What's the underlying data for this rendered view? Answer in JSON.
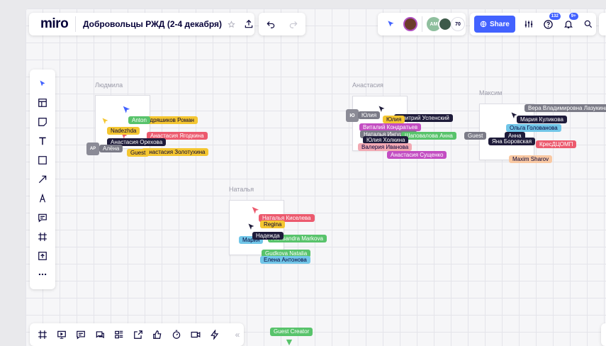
{
  "header": {
    "logo": "miro",
    "board_title": "Добровольцы РЖД (2-4 декабря)",
    "share_label": "Share",
    "collaborator_count": "70",
    "avatar_initials": "AM",
    "help_badge": "132",
    "notification_badge": "9+"
  },
  "left_toolbar": {
    "tools": [
      "select-tool",
      "templates-tool",
      "sticky-note-tool",
      "text-tool",
      "shape-tool",
      "pen-tool",
      "draw-tool",
      "comment-tool",
      "frame-tool",
      "upload-tool",
      "more-tools"
    ]
  },
  "frames": [
    {
      "label": "Людмила"
    },
    {
      "label": "Анастасия"
    },
    {
      "label": "Максим"
    },
    {
      "label": "Наталья"
    }
  ],
  "cursors_lyudmila": [
    {
      "text": "Anton",
      "color": "#58c36b"
    },
    {
      "text": "Кудряшиков Роман",
      "color": "#f4c631"
    },
    {
      "text": "Nadezhda",
      "color": "#f4c631"
    },
    {
      "text": "Анастасия Ягодкина",
      "color": "#ec5a6e"
    },
    {
      "text": "Анастасия Орехова",
      "color": "#1e1b3a"
    },
    {
      "text": "Анастасия Золотухина",
      "color": "#f4c631"
    },
    {
      "text": "Guest",
      "color": "#f4c631"
    },
    {
      "text": "Алёна",
      "color": "#7b7b87"
    },
    {
      "avatar": "AP"
    }
  ],
  "cursors_anastasia": [
    {
      "text": "Юлия",
      "color": "#7b7b87"
    },
    {
      "text": "Юлия",
      "color": "#f4c631"
    },
    {
      "text": "Дмитрий Успенский",
      "color": "#1e1b3a"
    },
    {
      "text": "Виталий Кондратьев",
      "color": "#c34dc2"
    },
    {
      "text": "Наталья Ингушина",
      "color": "#7b7b87"
    },
    {
      "text": "Юлия Холкина",
      "color": "#1e1b3a"
    },
    {
      "text": "Шаповалова Анна",
      "color": "#58c36b"
    },
    {
      "text": "Валерия Иванова",
      "color": "#f2a9b3"
    },
    {
      "text": "Анастасия Сущенко",
      "color": "#c34dc2"
    },
    {
      "avatar": "Ю"
    }
  ],
  "cursors_maxim": [
    {
      "text": "Вера Владимировна Лазукина",
      "color": "#7b7b87"
    },
    {
      "text": "Мария Куликова",
      "color": "#1e1b3a"
    },
    {
      "text": "Ольга Голованова",
      "color": "#71c6e8"
    },
    {
      "text": "Guest",
      "color": "#7b7b87"
    },
    {
      "text": "Анна",
      "color": "#1e1b3a"
    },
    {
      "text": "Яна Боровская",
      "color": "#1e1b3a"
    },
    {
      "text": "КресДЦОМП",
      "color": "#ec5a6e"
    },
    {
      "text": "Maxim Sharov",
      "color": "#f9c8a2"
    }
  ],
  "cursors_natalia": [
    {
      "text": "Наталья Киселева",
      "color": "#ec5a6e"
    },
    {
      "text": "Regina",
      "color": "#f4c631"
    },
    {
      "text": "Надежда",
      "color": "#1e1b3a"
    },
    {
      "text": "Мария",
      "color": "#71c6e8"
    },
    {
      "text": "Aleksandra Markova",
      "color": "#58c36b"
    },
    {
      "text": "Gudkova Natalia",
      "color": "#58c36b"
    },
    {
      "text": "Елена Антонова",
      "color": "#71c6e8"
    }
  ],
  "bottom_toolbar": {
    "tools": [
      "frames-icon",
      "presentation-icon",
      "comments-icon",
      "chat-icon",
      "cards-icon",
      "share-screen-icon",
      "reactions-icon",
      "timer-icon",
      "video-icon",
      "lightning-icon"
    ],
    "collapse": "«"
  },
  "guest_creator": {
    "text": "Guest Creator",
    "color": "#58c36b"
  },
  "colors": {
    "accent": "#4262ff",
    "text": "#050038",
    "board_bg": "#f6f6f8"
  }
}
